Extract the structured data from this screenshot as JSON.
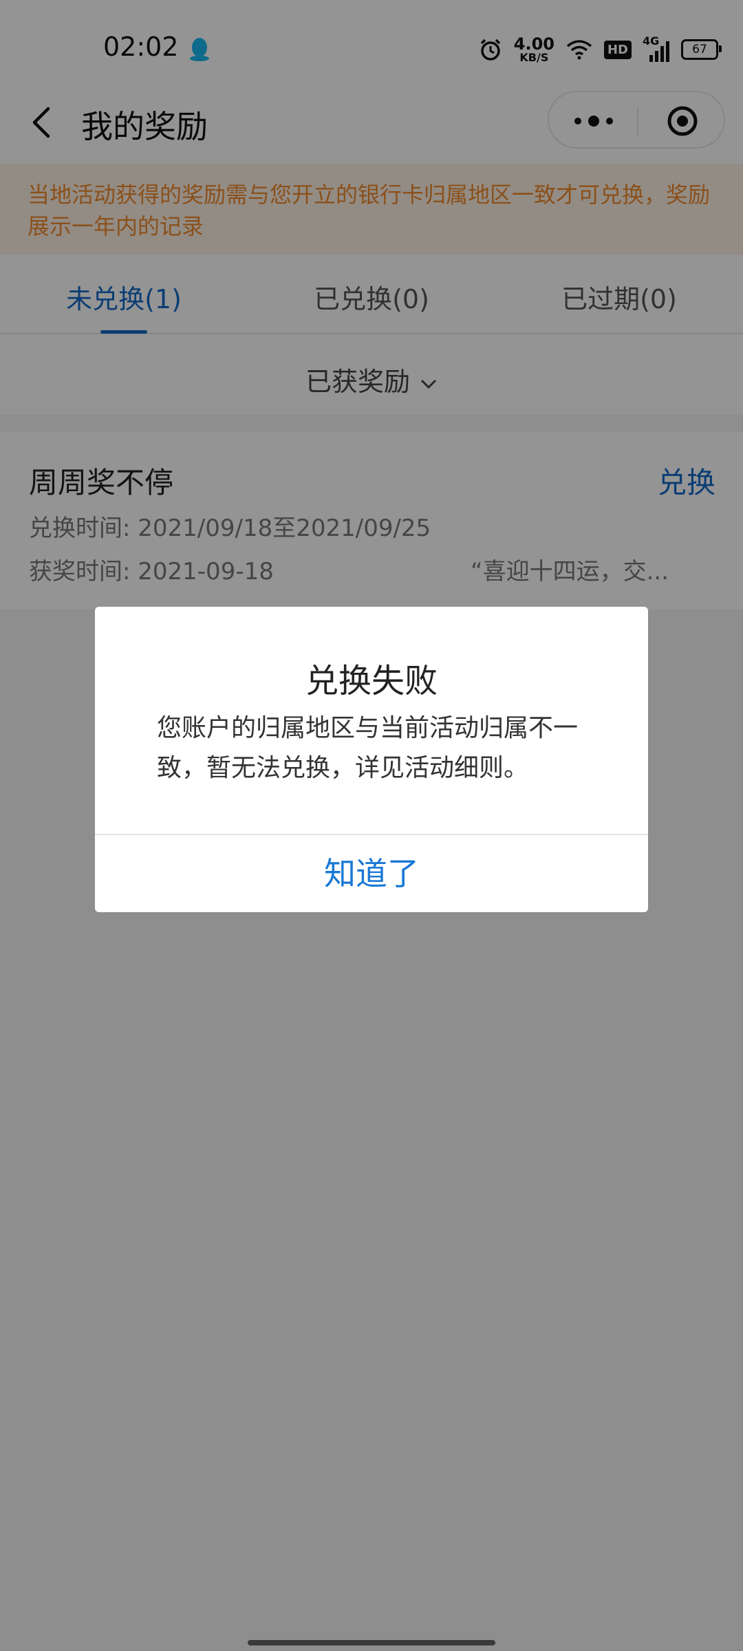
{
  "status_bar": {
    "time": "02:02",
    "net_speed_value": "4.00",
    "net_speed_unit": "KB/S",
    "hd_label": "HD",
    "signal_label": "4G",
    "battery": "67",
    "icons": [
      "qq-icon",
      "alarm-icon",
      "wifi-icon",
      "signal-icon",
      "battery-icon"
    ]
  },
  "nav": {
    "title": "我的奖励",
    "back_icon": "chevron-left-icon",
    "more_icon": "more-dots-icon",
    "close_icon": "target-circle-icon"
  },
  "notice": "当地活动获得的奖励需与您开立的银行卡归属地区一致才可兑换，奖励展示一年内的记录",
  "tabs": [
    {
      "label": "未兑换(1)",
      "active": true
    },
    {
      "label": "已兑换(0)",
      "active": false
    },
    {
      "label": "已过期(0)",
      "active": false
    }
  ],
  "filter": {
    "label": "已获奖励"
  },
  "reward": {
    "title": "周周奖不停",
    "action": "兑换",
    "redeem_time": "兑换时间: 2021/09/18至2021/09/25",
    "award_time": "获奖时间: 2021-09-18",
    "activity": "“喜迎十四运，交..."
  },
  "dialog": {
    "title": "兑换失败",
    "message": "您账户的归属地区与当前活动归属不一致，暂无法兑换，详见活动细则。",
    "button": "知道了"
  },
  "colors": {
    "accent": "#1469c9",
    "notice_text": "#f08a2e",
    "notice_bg": "#fdf1e4",
    "overlay": "rgba(0,0,0,0.42)",
    "dialog_button": "#1a78d6"
  }
}
